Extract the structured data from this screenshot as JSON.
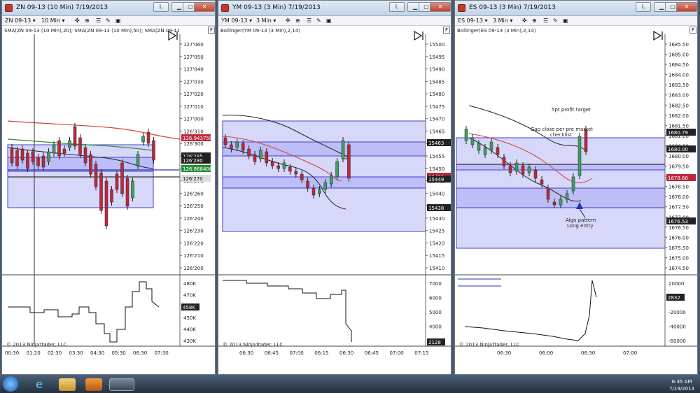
{
  "windows": [
    {
      "title": "ZN 09-13 (10 Min)  7/19/2013",
      "instrument": "ZN 09-13",
      "interval": "10 Min",
      "indicator": "SMA(ZN 09-13 (10 Min),20); SMA(ZN 09-13 (10 Min),50); SMA(ZN 09-13 (10 Min),",
      "price_ticks": [
        "127'060",
        "127'050",
        "127'040",
        "127'030",
        "127'020",
        "127'010",
        "127'000",
        "126'310",
        "126'300",
        "126'290",
        "126'280",
        "126'270",
        "126'260",
        "126'250",
        "126'240",
        "126'230",
        "126'220",
        "126'210",
        "126'200"
      ],
      "price_tags": [
        "126.943750",
        "126'285",
        "126'280",
        "126.868406",
        "126'270"
      ],
      "volume_ticks": [
        "480K",
        "470K",
        "460K",
        "450K",
        "440K",
        "430K"
      ],
      "volume_tag": "458K",
      "time_ticks": [
        "00:30",
        "01:20",
        "02:30",
        "03:30",
        "04:30",
        "05:30",
        "06:30",
        "07:30"
      ],
      "copyright": "© 2013 NinjaTrader, LLC",
      "btn_l": "L",
      "btn_f": "F"
    },
    {
      "title": "YM 09-13 (3 Min)  7/19/2013",
      "instrument": "YM 09-13",
      "interval": "3 Min",
      "indicator": "Bollinger(YM 09-13 (3 Min),2,14)",
      "price_ticks": [
        "15500",
        "15495",
        "15490",
        "15485",
        "15480",
        "15475",
        "15470",
        "15465",
        "15460",
        "15455",
        "15450",
        "15445",
        "15440",
        "15435",
        "15430",
        "15425",
        "15420",
        "15415",
        "15410"
      ],
      "price_tags": [
        "15463",
        "15451",
        "15449",
        "15438"
      ],
      "volume_ticks": [
        "7000",
        "6000",
        "5000",
        "4000",
        "3000"
      ],
      "volume_tag": "2128",
      "time_ticks": [
        "06:30",
        "06:45",
        "07:00",
        "06:15",
        "06:30",
        "06:45",
        "07:00",
        "07:15"
      ],
      "copyright": "© 2013 NinjaTrader, LLC",
      "btn_l": "L",
      "btn_f": "F"
    },
    {
      "title": "ES 09-13 (3 Min)  7/19/2013",
      "instrument": "ES 09-13",
      "interval": "3 Min",
      "indicator": "Bollinger(ES 09-13 (3 Min),2,14)",
      "price_ticks": [
        "1685.50",
        "1685.00",
        "1684.50",
        "1684.00",
        "1683.50",
        "1683.00",
        "1682.50",
        "1682.00",
        "1681.50",
        "1681.00",
        "1680.50",
        "1680.00",
        "1679.50",
        "1679.00",
        "1678.50",
        "1678.00",
        "1677.50",
        "1677.00",
        "1676.50",
        "1676.00",
        "1675.50",
        "1675.00",
        "1674.50"
      ],
      "price_tags": [
        "1680.79",
        "1680.00",
        "1678.66",
        "1676.53"
      ],
      "volume_ticks": [
        "20000",
        "0",
        "-20000",
        "-40000",
        "-60000"
      ],
      "volume_tag": "2832",
      "time_ticks": [
        "06:30",
        "06:00",
        "06:30",
        "07:00"
      ],
      "annotations": [
        "5pt profit target",
        "Gap close per pre market",
        "checklist",
        "Algo pattern",
        "Long entry"
      ],
      "copyright": "© 2013 NinjaTrader, LLC",
      "btn_l": "L",
      "btn_f": "F"
    }
  ],
  "taskbar": {
    "time": "6:35 AM",
    "date": "7/19/2013"
  },
  "colors": {
    "band": "#b8b8f0",
    "bull": "#3f9f5f",
    "bear": "#c0273a",
    "sma_red": "#d04040",
    "sma_green": "#2a8f3a",
    "sma_blue": "#2030c0"
  }
}
